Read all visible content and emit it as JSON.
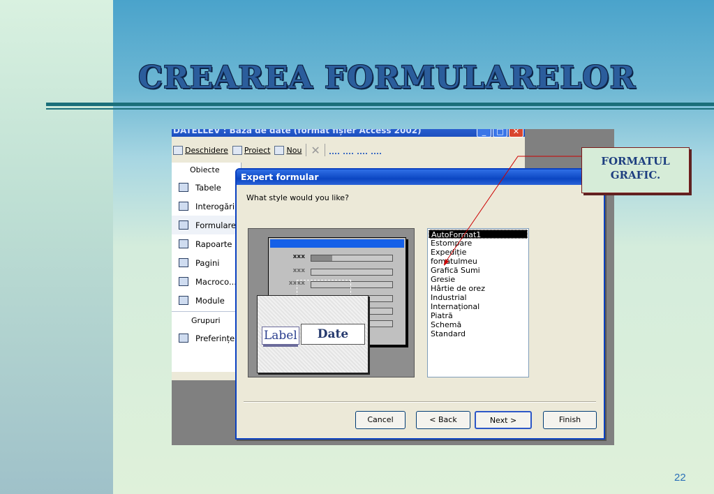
{
  "slide": {
    "title": "CREAREA FORMULARELOR",
    "page_number": "22",
    "callout": {
      "line1": "FORMATUL",
      "line2": "GRAFIC."
    },
    "colors": {
      "title": "#2b5d9c",
      "rule": "#1b6f7a",
      "callout_border": "#7a1a1a",
      "arrow": "#cc0000"
    }
  },
  "access_window": {
    "title": "DATELLEV : Baza de date (format fișier Access 2002)",
    "toolbar": {
      "open_label": "Deschidere",
      "design_label": "Proiect",
      "new_label": "Nou"
    },
    "objects_header": "Obiecte",
    "objects": [
      {
        "label": "Tabele",
        "icon": "table-icon"
      },
      {
        "label": "Interogări",
        "icon": "query-icon"
      },
      {
        "label": "Formulare",
        "icon": "form-icon"
      },
      {
        "label": "Rapoarte",
        "icon": "report-icon"
      },
      {
        "label": "Pagini",
        "icon": "page-icon"
      },
      {
        "label": "Macroco...",
        "icon": "macro-icon"
      },
      {
        "label": "Module",
        "icon": "module-icon"
      }
    ],
    "groups_header": "Grupuri",
    "groups": [
      {
        "label": "Preferințe",
        "icon": "favorites-icon"
      }
    ]
  },
  "wizard": {
    "title": "Expert formular",
    "question": "What style would you like?",
    "preview": {
      "label_text": "Label",
      "date_text": "Date",
      "field_markers": [
        "xxx",
        "xxx",
        "xxxx"
      ]
    },
    "styles": [
      "AutoFormat1",
      "Estompare",
      "Expediție",
      "fomatulmeu",
      "Grafică Sumi",
      "Gresie",
      "Hârtie de orez",
      "Industrial",
      "Internațional",
      "Piatră",
      "Schemă",
      "Standard"
    ],
    "selected_style": "AutoFormat1",
    "buttons": {
      "cancel": "Cancel",
      "back": "< Back",
      "next": "Next >",
      "finish": "Finish"
    }
  }
}
